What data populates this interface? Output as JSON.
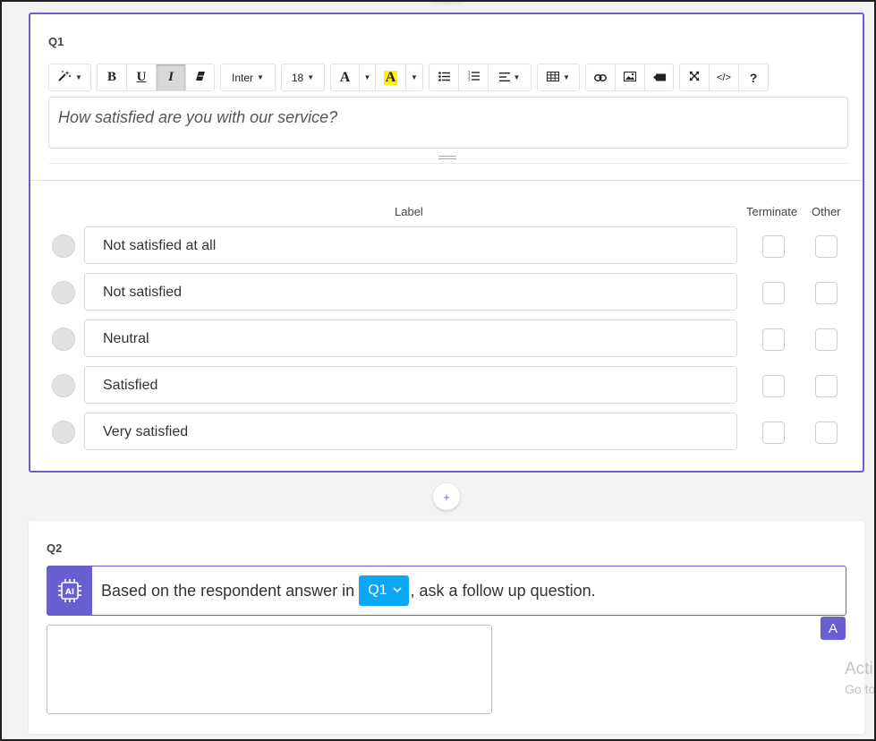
{
  "q1": {
    "label": "Q1",
    "toolbar": {
      "font_name": "Inter",
      "font_size": "18",
      "bold": "B",
      "underline": "U",
      "italic": "I",
      "help": "?"
    },
    "question_text": "How satisfied are you with our service?",
    "columns": {
      "label": "Label",
      "terminate": "Terminate",
      "other": "Other"
    },
    "options": [
      {
        "label": "Not satisfied at all"
      },
      {
        "label": "Not satisfied"
      },
      {
        "label": "Neutral"
      },
      {
        "label": "Satisfied"
      },
      {
        "label": "Very satisfied"
      }
    ]
  },
  "add_button": "+",
  "q2": {
    "label": "Q2",
    "ai_icon_text": "AI",
    "prompt_before": "Based on the respondent answer in",
    "selected_question": "Q1",
    "prompt_after": ", ask a follow up question.",
    "a_button": "A",
    "answer_value": ""
  },
  "watermark": {
    "line1": "Acti",
    "line2": "Go to"
  },
  "colors": {
    "accent": "#6a5fd0",
    "select_blue": "#0ba6f5"
  }
}
